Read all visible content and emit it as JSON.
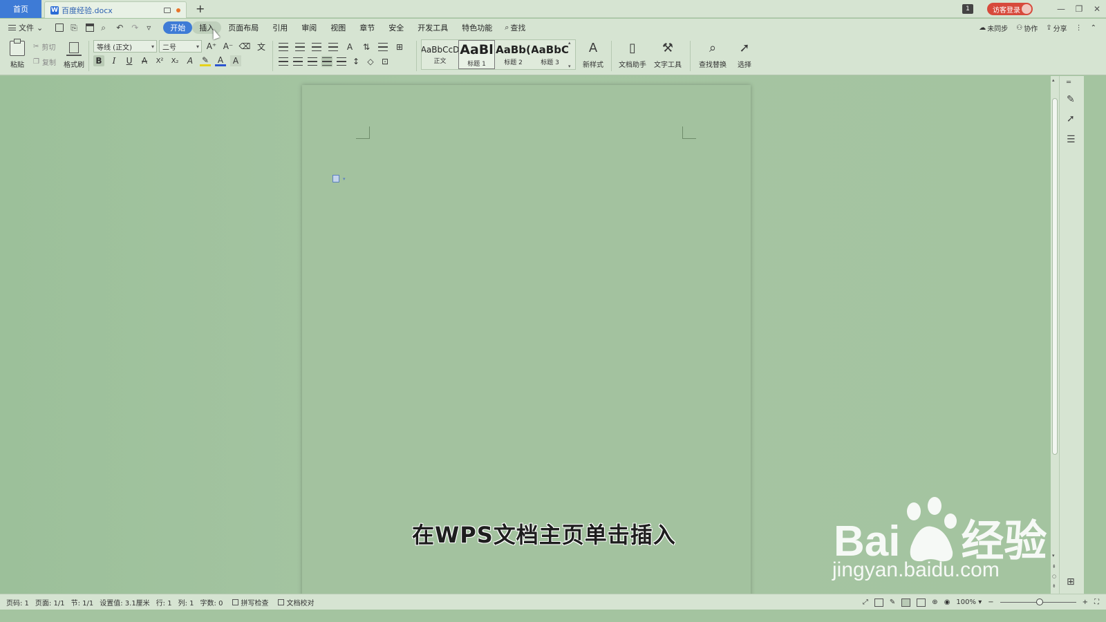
{
  "titlebar": {
    "home_tab": "首页",
    "doc_tab": "百度经验.docx",
    "doc_icon_letter": "W",
    "new_tab": "+",
    "badge": "1",
    "login": "访客登录",
    "minimize": "—",
    "maximize": "❐",
    "close": "✕"
  },
  "menu": {
    "file": "文件",
    "tabs": [
      {
        "label": "开始",
        "state": "active"
      },
      {
        "label": "插入",
        "state": "hover"
      },
      {
        "label": "页面布局"
      },
      {
        "label": "引用"
      },
      {
        "label": "审阅"
      },
      {
        "label": "视图"
      },
      {
        "label": "章节"
      },
      {
        "label": "安全"
      },
      {
        "label": "开发工具"
      },
      {
        "label": "特色功能"
      }
    ],
    "search": "查找",
    "sync": "未同步",
    "collab": "协作",
    "share": "分享"
  },
  "ribbon": {
    "paste": "粘贴",
    "cut": "剪切",
    "copy": "复制",
    "format_painter": "格式刷",
    "font_name": "等线 (正文)",
    "font_size": "二号",
    "bold": "B",
    "italic": "I",
    "underline": "U",
    "strike": "A",
    "superscript": "X²",
    "subscript": "X₂",
    "text_effect": "A",
    "highlight": "✎",
    "font_color": "A",
    "clear_char": "A",
    "grow_font": "A⁺",
    "shrink_font": "A⁻",
    "styles": [
      {
        "preview": "AaBbCcD",
        "name": "正文"
      },
      {
        "preview": "AaBl",
        "name": "标题 1"
      },
      {
        "preview": "AaBb(",
        "name": "标题 2"
      },
      {
        "preview": "AaBbC",
        "name": "标题 3"
      }
    ],
    "new_style": "新样式",
    "doc_assistant": "文档助手",
    "text_tools": "文字工具",
    "find_replace": "查找替换",
    "select": "选择"
  },
  "document": {
    "caption": "在WPS文档主页单击插入"
  },
  "watermark": {
    "brand_left": "Bai",
    "brand_right": "经验",
    "url": "jingyan.baidu.com"
  },
  "status": {
    "page_num": "页码: 1",
    "pages": "页面: 1/1",
    "section": "节: 1/1",
    "setting": "设置值: 3.1厘米",
    "row": "行: 1",
    "col": "列: 1",
    "words": "字数: 0",
    "spell_check": "拼写检查",
    "doc_proof": "文档校对",
    "zoom": "100%",
    "zoom_out": "−",
    "zoom_in": "+"
  },
  "colors": {
    "accent": "#3e7bd6",
    "login": "#d74a3c",
    "page": "#a3c29f"
  }
}
